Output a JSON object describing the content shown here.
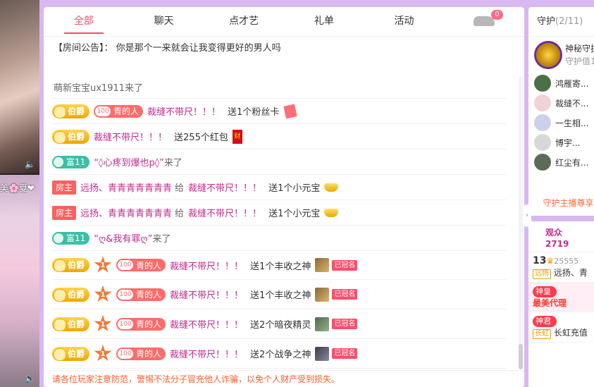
{
  "left": {
    "video2_tag": "美🌸夏❤",
    "vol_icon": "🔈"
  },
  "tabs": [
    {
      "label": "全部"
    },
    {
      "label": "聊天"
    },
    {
      "label": "点才艺"
    },
    {
      "label": "礼单"
    },
    {
      "label": "活动"
    }
  ],
  "car_badge": "0",
  "notice": {
    "tag": "【房间公告】：",
    "text": "你是那个一来就会让我变得更好的男人吗"
  },
  "messages": {
    "m0": {
      "name": "萌新宝宝ux1911",
      "action": "来了"
    },
    "m1": {
      "badge": "伯爵",
      "fan_lv": "100",
      "fan": "青的人",
      "name": "裁缝不带尺！！！",
      "action": "送1个粉丝卡"
    },
    "m2": {
      "badge": "伯爵",
      "name": "裁缝不带尺！！！",
      "action": "送255个红包",
      "gift_text": "财"
    },
    "m3": {
      "badge": "富11",
      "name": "“◊心疼到爆也p◊”",
      "action": "来了"
    },
    "m4": {
      "host": "房主",
      "name": "远扬、青青青青青青青",
      "mid": "给",
      "name2": "裁缝不带尺！！！",
      "action": "送1个小元宝"
    },
    "m5": {
      "host": "房主",
      "name": "远扬、青青青青青青青",
      "mid": "给",
      "name2": "裁缝不带尺！！！",
      "action": "送1个小元宝"
    },
    "m6": {
      "badge": "富11",
      "name": "“ღ&我有罪ღ”",
      "action": "来了"
    },
    "m7": {
      "badge": "伯爵",
      "rank": "1",
      "fan_lv": "100",
      "fan": "青的人",
      "name": "裁缝不带尺！！！",
      "action": "送1个丰收之神",
      "crown": "已冠名"
    },
    "m8": {
      "badge": "伯爵",
      "rank": "1",
      "fan_lv": "100",
      "fan": "青的人",
      "name": "裁缝不带尺！！！",
      "action": "送1个丰收之神",
      "crown": "已冠名"
    },
    "m9": {
      "badge": "伯爵",
      "rank": "1",
      "fan_lv": "100",
      "fan": "青的人",
      "name": "裁缝不带尺！！！",
      "action": "送2个暗夜精灵",
      "crown": "已冠名"
    },
    "m10": {
      "badge": "伯爵",
      "rank": "1",
      "fan_lv": "100",
      "fan": "青的人",
      "name": "裁缝不带尺！！！",
      "action": "送2个战争之神",
      "crown": "已冠名"
    }
  },
  "footer_warning": "请各位玩家注意防范，警惕不法分子冒充他人诈骗，以免个人财产受到损失。",
  "guard": {
    "title": "守护",
    "count": "(2/11)",
    "tail": "",
    "top_name": "神秘守护",
    "top_sub": "守护值1",
    "items": [
      "鸿雁寄...",
      "裁缝不...",
      "一生相...",
      "博宇...",
      "红尘有..."
    ],
    "link": "守护主播尊享"
  },
  "audience": {
    "title": "观众",
    "count": "2719",
    "r1_lv": "13",
    "r1_num": "25555",
    "r1_badge": "远扬",
    "r1_name": "远扬、青",
    "r2_badge": "神皇",
    "r2_text": "最美代理",
    "r3_badge": "神君",
    "r3_tag": "长虹",
    "r3_name": "长虹充值"
  },
  "colors": {
    "accent": "#ff4a6b",
    "name": "#c42a8e",
    "warning": "#ff5a2a",
    "background": "#d8b8f0"
  }
}
